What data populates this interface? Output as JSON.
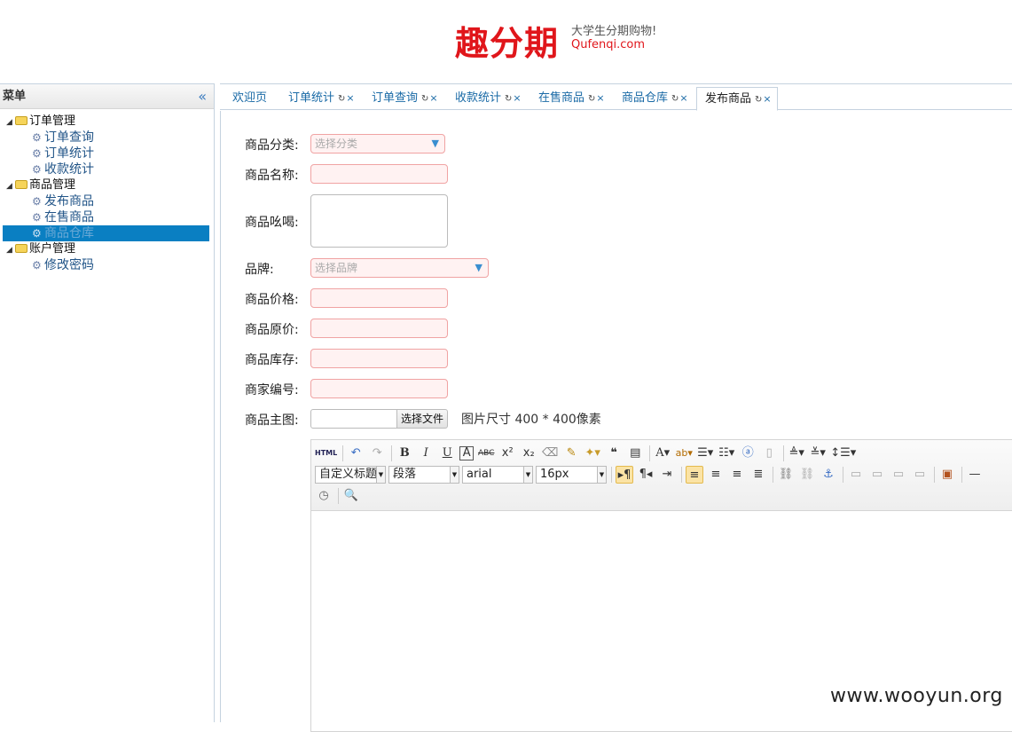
{
  "header": {
    "brand": "趣分期",
    "tagline": "大学生分期购物!",
    "url": "Qufenqi.com"
  },
  "sidebar": {
    "title": "菜单",
    "collapse_icon": "«",
    "groups": [
      {
        "label": "订单管理",
        "items": [
          "订单查询",
          "订单统计",
          "收款统计"
        ]
      },
      {
        "label": "商品管理",
        "items": [
          "发布商品",
          "在售商品",
          "商品仓库"
        ]
      },
      {
        "label": "账户管理",
        "items": [
          "修改密码"
        ]
      }
    ],
    "selected_item": "商品仓库"
  },
  "tabs": [
    {
      "label": "欢迎页",
      "closable": false
    },
    {
      "label": "订单统计",
      "closable": true
    },
    {
      "label": "订单查询",
      "closable": true
    },
    {
      "label": "收款统计",
      "closable": true
    },
    {
      "label": "在售商品",
      "closable": true
    },
    {
      "label": "商品仓库",
      "closable": true
    },
    {
      "label": "发布商品",
      "closable": true,
      "active": true
    }
  ],
  "form": {
    "category_label": "商品分类:",
    "category_placeholder": "选择分类",
    "name_label": "商品名称:",
    "slogan_label": "商品吆喝:",
    "brand_label": "品牌:",
    "brand_placeholder": "选择品牌",
    "price_label": "商品价格:",
    "original_price_label": "商品原价:",
    "stock_label": "商品库存:",
    "merchant_code_label": "商家编号:",
    "main_image_label": "商品主图:",
    "file_button": "选择文件",
    "image_hint": "图片尺寸 400 * 400像素"
  },
  "editor": {
    "heading_combo": "自定义标题",
    "paragraph_combo": "段落",
    "font_combo": "arial",
    "size_combo": "16px"
  },
  "watermark": "www.wooyun.org"
}
